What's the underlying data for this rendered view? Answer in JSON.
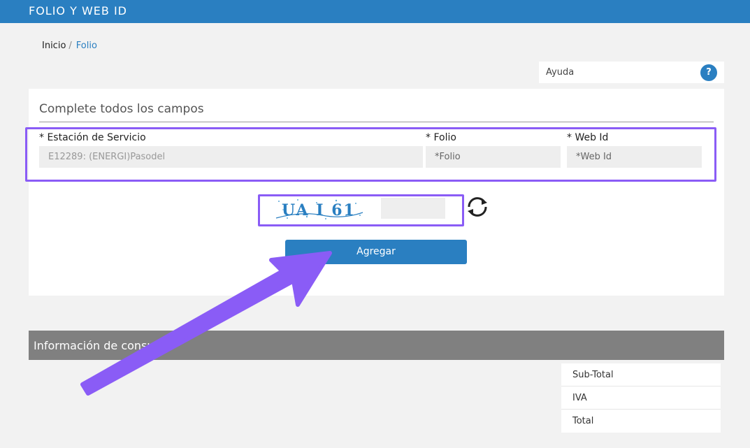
{
  "header": {
    "title": "FOLIO Y WEB ID"
  },
  "breadcrumb": {
    "home": "Inicio",
    "separator": "/",
    "current": "Folio"
  },
  "help": {
    "label": "Ayuda",
    "icon": "?"
  },
  "form": {
    "heading": "Complete todos los campos",
    "station": {
      "label": "* Estación de Servicio",
      "value": "E12289: (ENERGI)Pasodel"
    },
    "folio": {
      "label": "* Folio",
      "placeholder": "*Folio"
    },
    "webid": {
      "label": "* Web Id",
      "placeholder": "*Web Id"
    },
    "captcha": {
      "text": "UA I 61"
    },
    "submit_label": "Agregar"
  },
  "consumption": {
    "title": "Información de consum"
  },
  "totals": {
    "rows": [
      "Sub-Total",
      "IVA",
      "Total"
    ]
  },
  "colors": {
    "primary": "#2a7fc1",
    "highlight": "#8a5cf6",
    "section_bar": "#808080",
    "background": "#f2f2f2"
  }
}
